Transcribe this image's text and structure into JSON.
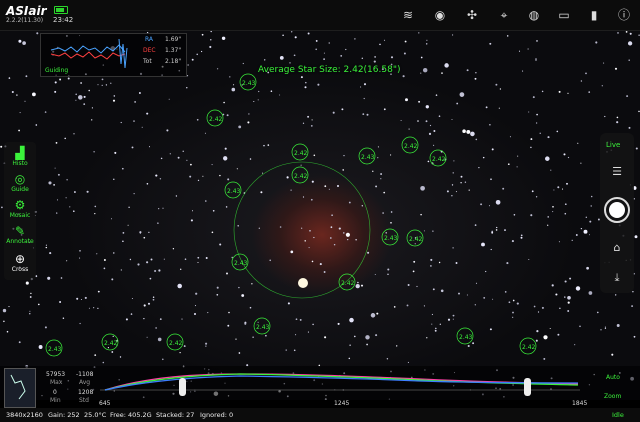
{
  "topbar": {
    "app_name": "ASIair",
    "version": "2.2.2(11.30)",
    "time": "23:42",
    "icons": [
      "wifi-icon",
      "camera-icon",
      "filter-wheel-icon",
      "telescope-icon",
      "focuser-icon",
      "mount-icon",
      "storage-icon",
      "info-icon"
    ]
  },
  "guide": {
    "title": "Guiding",
    "ra_label": "RA",
    "dec_label": "DEC",
    "total_label": "Tot",
    "ra_value": "1.69\"",
    "dec_value": "1.37\"",
    "total_value": "2.18\""
  },
  "overlay": {
    "avg_star_size": "Average Star Size: 2.42(16.58\")",
    "circle_labels": [
      "2.42",
      "2.43",
      "2.42",
      "2.43",
      "2.42",
      "2.43",
      "2.42",
      "2.42",
      "2.43",
      "2.42",
      "2.43",
      "2.42",
      "2.43",
      "2.42",
      "2.43",
      "2.42",
      "2.43",
      "2.42"
    ]
  },
  "leftbar": {
    "items": [
      {
        "name": "histogram",
        "label": "Histo"
      },
      {
        "name": "guide",
        "label": "Guide"
      },
      {
        "name": "mosaic",
        "label": "Mosaic"
      },
      {
        "name": "annotate",
        "label": "Annotate"
      },
      {
        "name": "cross",
        "label": "Cross"
      }
    ]
  },
  "rightbar": {
    "live_label": "Live"
  },
  "histogram": {
    "max_value": "57953",
    "max_label": "Max",
    "avg_value": "-1108",
    "avg_label": "Avg",
    "min_value": "0",
    "min_label": "Min",
    "std_value": "1208",
    "std_label": "Std",
    "axis_left": "645",
    "axis_mid": "1245",
    "axis_right": "1845",
    "auto_label": "Auto",
    "zoom_label": "Zoom"
  },
  "status": {
    "resolution": "3840x2160",
    "gain": "Gain: 252",
    "temp": "25.0°C",
    "free": "Free: 405.2G",
    "stacked": "Stacked: 27",
    "ignored": "Ignored: 0",
    "state": "Idle"
  },
  "colors": {
    "accent": "#3bf33b",
    "ra": "#4aa3ff",
    "dec": "#ff4040",
    "histo_red": "#ff3fa6",
    "histo_green": "#3bf33b",
    "histo_blue": "#3d7dff"
  }
}
